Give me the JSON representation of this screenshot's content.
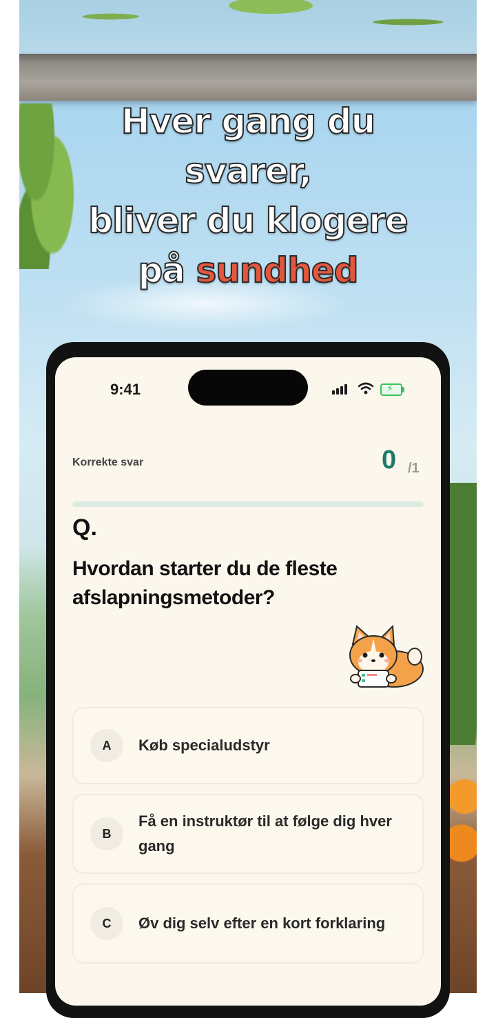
{
  "headline": {
    "line1": "Hver gang du",
    "line2": "svarer,",
    "line3": "bliver du klogere",
    "line4_prefix": "på",
    "line4_highlight": "sundhed"
  },
  "status_bar": {
    "time": "9:41"
  },
  "quiz": {
    "correct_label": "Korrekte svar",
    "score": "0",
    "total": "/1",
    "progress": 0,
    "q_mark": "Q.",
    "question": "Hvordan starter du de fleste afslapningsmetoder?",
    "options": [
      {
        "letter": "A",
        "text": "Køb specialudstyr"
      },
      {
        "letter": "B",
        "text": "Få en instruktør til at følge dig hver gang"
      },
      {
        "letter": "C",
        "text": "Øv dig selv efter en kort forklaring"
      }
    ]
  },
  "colors": {
    "accent": "#1f7a68",
    "highlight": "#e4573d",
    "screen_bg": "#fbf7ec"
  }
}
